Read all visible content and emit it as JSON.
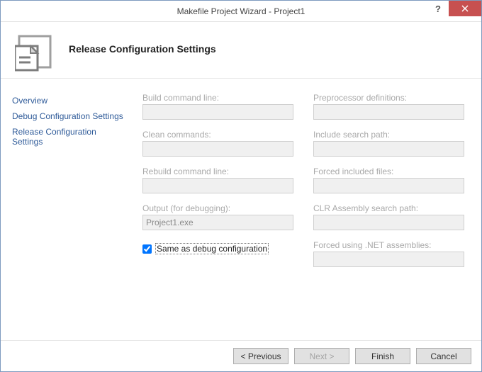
{
  "window": {
    "title": "Makefile Project Wizard - Project1"
  },
  "header": {
    "title": "Release Configuration Settings"
  },
  "sidebar": {
    "items": [
      {
        "label": "Overview"
      },
      {
        "label": "Debug Configuration Settings"
      },
      {
        "label": "Release Configuration Settings"
      }
    ]
  },
  "form": {
    "left": {
      "build_cmd": {
        "label": "Build command line:",
        "value": ""
      },
      "clean_cmd": {
        "label": "Clean commands:",
        "value": ""
      },
      "rebuild_cmd": {
        "label": "Rebuild command line:",
        "value": ""
      },
      "output": {
        "label": "Output (for debugging):",
        "value": "Project1.exe"
      }
    },
    "right": {
      "preproc": {
        "label": "Preprocessor definitions:",
        "value": ""
      },
      "include": {
        "label": "Include search path:",
        "value": ""
      },
      "forced": {
        "label": "Forced included files:",
        "value": ""
      },
      "clrpath": {
        "label": "CLR Assembly search path:",
        "value": ""
      },
      "netasm": {
        "label": "Forced using .NET assemblies:",
        "value": ""
      }
    },
    "same_as_debug": {
      "label": "Same as debug configuration",
      "checked": true
    }
  },
  "buttons": {
    "previous": "< Previous",
    "next": "Next >",
    "finish": "Finish",
    "cancel": "Cancel"
  }
}
